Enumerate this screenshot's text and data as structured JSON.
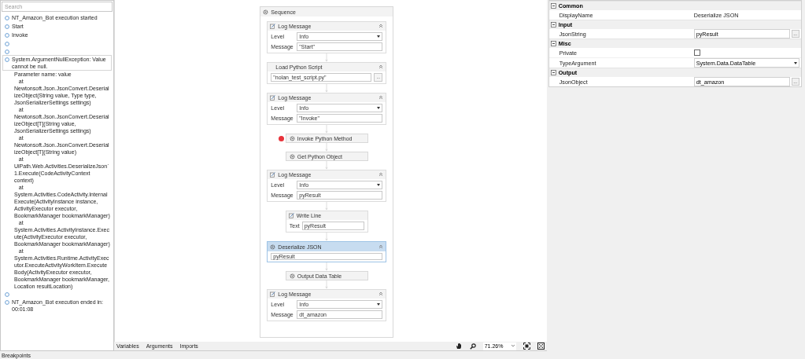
{
  "output_panel": {
    "search": {
      "placeholder": "Search"
    },
    "entries": [
      {
        "kind": "message",
        "text": "NT_Amazon_Bot execution started"
      },
      {
        "kind": "message",
        "text": "Start"
      },
      {
        "kind": "message",
        "text": "Invoke"
      },
      {
        "kind": "blank"
      },
      {
        "kind": "blank"
      },
      {
        "kind": "error",
        "selected": true,
        "text": "System.ArgumentNullException: Value cannot be null.",
        "details": [
          "Parameter name: value",
          "   at Newtonsoft.Json.JsonConvert.DeserializeObject(String value, Type type, JsonSerializerSettings settings)",
          "   at Newtonsoft.Json.JsonConvert.DeserializeObject[T](String value, JsonSerializerSettings settings)",
          "   at Newtonsoft.Json.JsonConvert.DeserializeObject[T](String value)",
          "   at UiPath.Web.Activities.DeserializeJson`1.Execute(CodeActivityContext context)",
          "   at System.Activities.CodeActivity.InternalExecute(ActivityInstance instance, ActivityExecutor executor, BookmarkManager bookmarkManager)",
          "   at System.Activities.ActivityInstance.Execute(ActivityExecutor executor, BookmarkManager bookmarkManager)",
          "   at System.Activities.Runtime.ActivityExecutor.ExecuteActivityWorkItem.ExecuteBody(ActivityExecutor executor, BookmarkManager bookmarkManager, Location resultLocation)"
        ]
      },
      {
        "kind": "blank"
      },
      {
        "kind": "message",
        "text": "NT_Amazon_Bot execution ended in: 00:01:08"
      }
    ]
  },
  "designer": {
    "sequence": {
      "title": "Sequence",
      "activities": [
        {
          "kind": "log",
          "title": "Log Message",
          "selected": false,
          "level_label": "Level",
          "level": "Info",
          "message_label": "Message",
          "message": "\"Start\""
        },
        {
          "kind": "script",
          "title": "Load Python Script",
          "selected": false,
          "value": "\"nolan_test_script.py\"",
          "button": "..."
        },
        {
          "kind": "log",
          "title": "Log Message",
          "selected": false,
          "level_label": "Level",
          "level": "Info",
          "message_label": "Message",
          "message": "\"Invoke\""
        },
        {
          "kind": "compact",
          "title": "Invoke Python Method",
          "selected": false,
          "breakpoint": true
        },
        {
          "kind": "compact",
          "title": "Get Python Object",
          "selected": false,
          "breakpoint": false
        },
        {
          "kind": "log",
          "title": "Log Message",
          "selected": false,
          "level_label": "Level",
          "level": "Info",
          "message_label": "Message",
          "message": "pyResult"
        },
        {
          "kind": "writeline",
          "title": "Write Line",
          "selected": false,
          "label": "Text",
          "value": "pyResult"
        },
        {
          "kind": "deserialize",
          "title": "Deserialize JSON",
          "selected": true,
          "value": "pyResult"
        },
        {
          "kind": "compact",
          "title": "Output Data Table",
          "selected": false,
          "breakpoint": false
        },
        {
          "kind": "log",
          "title": "Log Message",
          "selected": false,
          "level_label": "Level",
          "level": "Info",
          "message_label": "Message",
          "message": "dt_amazon"
        }
      ]
    },
    "footer": {
      "tabs": [
        "Variables",
        "Arguments",
        "Imports"
      ],
      "zoom": "71.26%"
    }
  },
  "properties": {
    "categories": [
      {
        "name": "Common",
        "expanded": true,
        "rows": [
          {
            "kind": "text",
            "label": "DisplayName",
            "value": "Deserialize JSON"
          }
        ]
      },
      {
        "name": "Input",
        "expanded": true,
        "rows": [
          {
            "kind": "field",
            "label": "JsonString",
            "value": "pyResult",
            "button": "..."
          }
        ]
      },
      {
        "name": "Misc",
        "expanded": true,
        "rows": [
          {
            "kind": "checkbox",
            "label": "Private",
            "checked": false
          },
          {
            "kind": "dropdown",
            "label": "TypeArgument",
            "value": "System.Data.DataTable"
          }
        ]
      },
      {
        "name": "Output",
        "expanded": true,
        "rows": [
          {
            "kind": "field",
            "label": "JsonObject",
            "value": "dt_amazon",
            "button": "..."
          }
        ]
      }
    ]
  },
  "bottom_bar": {
    "label": "Breakpoints"
  }
}
